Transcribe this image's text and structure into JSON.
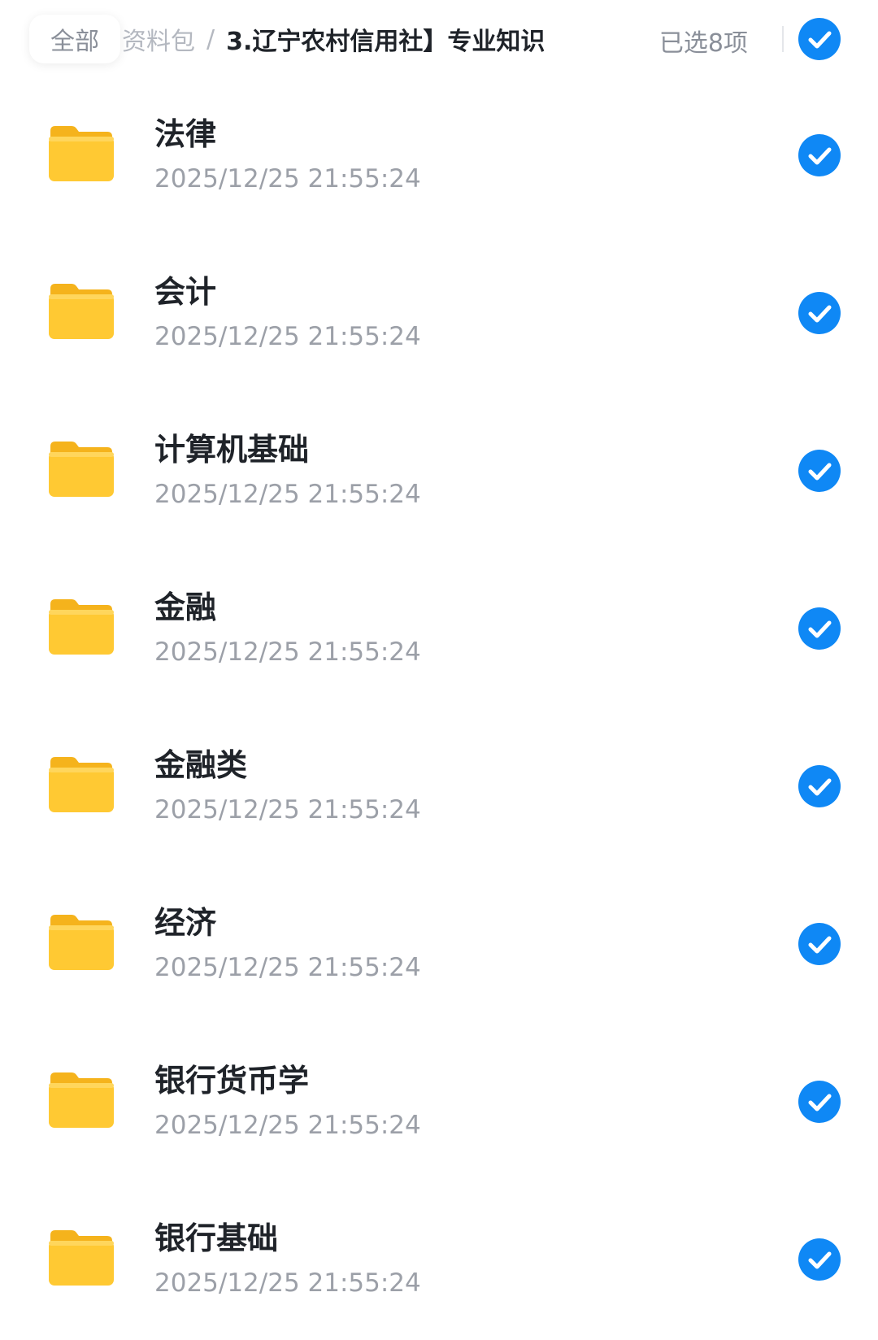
{
  "header": {
    "root_label": "全部",
    "prev_folder": "资料包",
    "separator": "/",
    "current_folder": "3.辽宁农村信用社】专业知识",
    "selected_count_label": "已选8项"
  },
  "colors": {
    "accent": "#0f88f5",
    "folder": "#ffc933",
    "muted_text": "#9ca0a8"
  },
  "items": [
    {
      "name": "法律",
      "time": "2025/12/25 21:55:24",
      "checked": true,
      "icon": "folder-icon"
    },
    {
      "name": "会计",
      "time": "2025/12/25 21:55:24",
      "checked": true,
      "icon": "folder-icon"
    },
    {
      "name": "计算机基础",
      "time": "2025/12/25 21:55:24",
      "checked": true,
      "icon": "folder-icon"
    },
    {
      "name": "金融",
      "time": "2025/12/25 21:55:24",
      "checked": true,
      "icon": "folder-icon"
    },
    {
      "name": "金融类",
      "time": "2025/12/25 21:55:24",
      "checked": true,
      "icon": "folder-icon"
    },
    {
      "name": "经济",
      "time": "2025/12/25 21:55:24",
      "checked": true,
      "icon": "folder-icon"
    },
    {
      "name": "银行货币学",
      "time": "2025/12/25 21:55:24",
      "checked": true,
      "icon": "folder-icon"
    },
    {
      "name": "银行基础",
      "time": "2025/12/25 21:55:24",
      "checked": true,
      "icon": "folder-icon"
    }
  ]
}
